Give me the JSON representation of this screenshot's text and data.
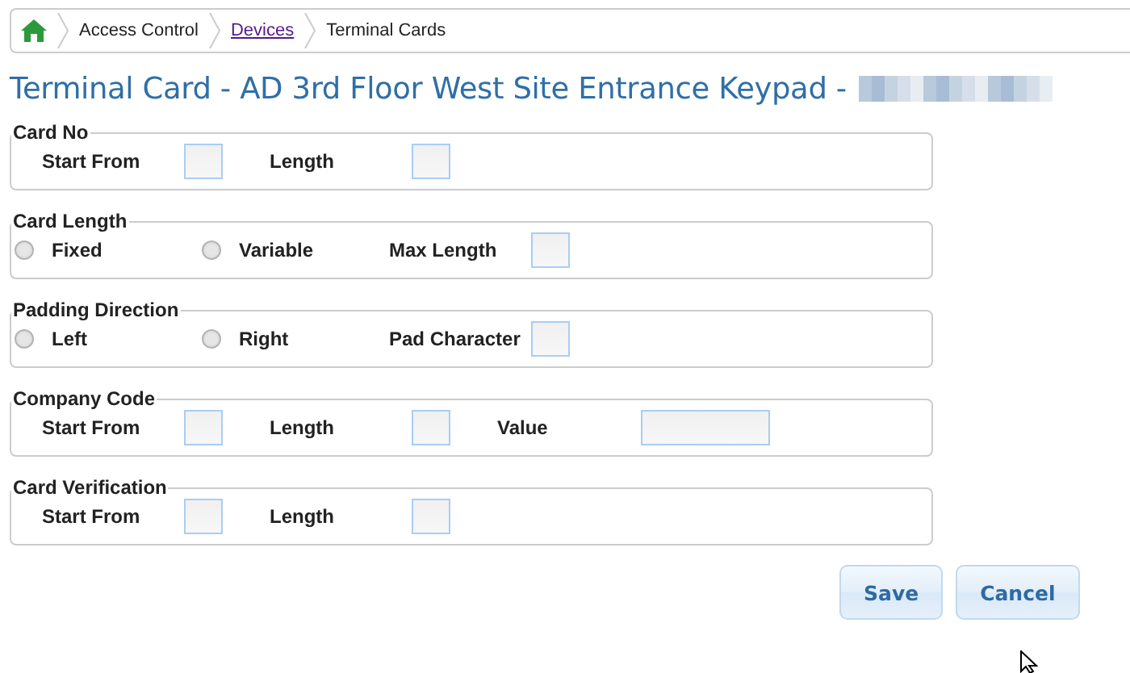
{
  "breadcrumb": [
    {
      "label": "Access Control",
      "kind": "text"
    },
    {
      "label": "Devices",
      "kind": "link"
    },
    {
      "label": "Terminal Cards",
      "kind": "text"
    }
  ],
  "title": "Terminal Card - AD 3rd Floor West Site Entrance Keypad -",
  "sections": [
    {
      "legend": "Card No",
      "items": [
        {
          "kind": "field",
          "label": "Start From"
        },
        {
          "kind": "field",
          "label": "Length"
        }
      ]
    },
    {
      "legend": "Card Length",
      "items": [
        {
          "kind": "radio",
          "label": "Fixed",
          "selected": false
        },
        {
          "kind": "radio",
          "label": "Variable",
          "selected": false
        },
        {
          "kind": "field",
          "label": "Max Length"
        }
      ]
    },
    {
      "legend": "Padding Direction",
      "items": [
        {
          "kind": "radio",
          "label": "Left",
          "selected": false
        },
        {
          "kind": "radio",
          "label": "Right",
          "selected": false
        },
        {
          "kind": "field",
          "label": "Pad Character"
        }
      ]
    },
    {
      "legend": "Company Code",
      "items": [
        {
          "kind": "field",
          "label": "Start From"
        },
        {
          "kind": "field",
          "label": "Length"
        },
        {
          "kind": "wide-field",
          "label": "Value"
        }
      ]
    },
    {
      "legend": "Card Verification",
      "items": [
        {
          "kind": "field",
          "label": "Start From"
        },
        {
          "kind": "field",
          "label": "Length"
        }
      ]
    }
  ],
  "buttons": [
    "Save",
    "Cancel"
  ]
}
